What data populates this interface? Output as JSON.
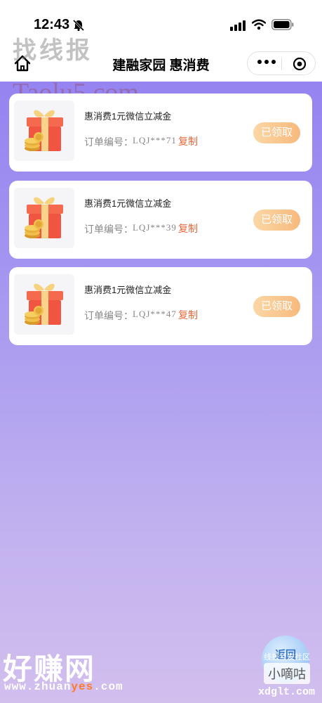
{
  "status_bar": {
    "time": "12:43",
    "icons": [
      "bell-off-icon",
      "signal-icon",
      "wifi-icon",
      "battery-icon"
    ]
  },
  "nav": {
    "title": "建融家园 惠消费",
    "home_icon": "home-icon",
    "more_icon": "more-icon",
    "close_icon": "target-icon"
  },
  "vouchers": [
    {
      "title": "惠消费1元微信立减金",
      "order_label": "订单编号：",
      "order_no": "LQJ***71",
      "copy_label": "复制",
      "status_label": "已领取",
      "image_icon": "gift-box-icon"
    },
    {
      "title": "惠消费1元微信立减金",
      "order_label": "订单编号：",
      "order_no": "LQJ***39",
      "copy_label": "复制",
      "status_label": "已领取",
      "image_icon": "gift-box-icon"
    },
    {
      "title": "惠消费1元微信立减金",
      "order_label": "订单编号：",
      "order_no": "LQJ***47",
      "copy_label": "复制",
      "status_label": "已领取",
      "image_icon": "gift-box-icon"
    }
  ],
  "float_button": {
    "label": "返回"
  },
  "watermarks": {
    "top": "找线报",
    "taolu": "Taolu5.com",
    "bottom": "好赚网",
    "url_prefix": "www.zhuan",
    "url_highlight": "yes",
    "url_suffix": ".com",
    "right_small": "线报互发社区",
    "right_box": "小嘀咕",
    "xdglt": "xdglt.com"
  },
  "colors": {
    "accent": "#e6683a",
    "claimed_button": "#f7b97c",
    "background_top": "#8f7cf0",
    "background_bottom": "#d2bfee"
  }
}
